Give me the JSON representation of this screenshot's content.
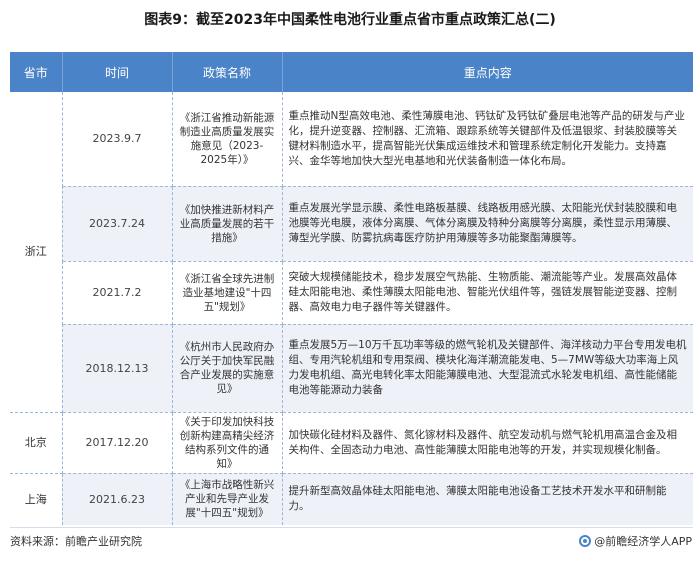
{
  "title": "图表9：截至2023年中国柔性电池行业重点省市重点政策汇总(二)",
  "headers": {
    "province": "省市",
    "time": "时间",
    "policy": "政策名称",
    "content": "重点内容"
  },
  "groups": [
    {
      "province": "浙江",
      "rows": [
        {
          "time": "2023.9.7",
          "policy": "《浙江省推动新能源制造业高质量发展实施意见（2023-2025年）》",
          "content": "重点推动N型高效电池、柔性薄膜电池、钙钛矿及钙钛矿叠层电池等产品的研发与产业化，提升逆变器、控制器、汇流箱、跟踪系统等关键部件及低温银浆、封装胶膜等关键材料制造水平，提高智能光伏集成运维技术和管理系统定制化开发能力。支持嘉兴、金华等地加快大型光电基地和光伏装备制造一体化布局。"
        },
        {
          "time": "2023.7.24",
          "policy": "《加快推进新材料产业高质量发展的若干措施》",
          "content": "重点发展光学显示膜、柔性电路板基膜、线路板用感光膜、太阳能光伏封装胶膜和电池膜等光电膜，液体分离膜、气体分离膜及特种分离膜等分离膜，柔性显示用薄膜、薄型光学膜、防雾抗病毒医疗防护用薄膜等多功能聚酯薄膜等。"
        },
        {
          "time": "2021.7.2",
          "policy": "《浙江省全球先进制造业基地建设\"十四五\"规划》",
          "content": "突破大规模储能技术，稳步发展空气热能、生物质能、潮流能等产业。发展高效晶体硅太阳能电池、柔性薄膜太阳能电池、智能光伏组件等，强链发展智能逆变器、控制器、高效电力电子器件等关键器件。"
        },
        {
          "time": "2018.12.13",
          "policy": "《杭州市人民政府办公厅关于加快军民融合产业发展的实施意见》",
          "content": "重点发展5万—10万千瓦功率等级的燃气轮机及关键部件、海洋核动力平台专用发电机组、专用汽轮机组和专用泵阀、模块化海洋潮流能发电、5—7MW等级大功率海上风力发电机组、高光电转化率太阳能薄膜电池、大型混流式水轮发电机组、高性能储能电池等能源动力装备"
        }
      ]
    },
    {
      "province": "北京",
      "rows": [
        {
          "time": "2017.12.20",
          "policy": "《关于印发加快科技创新构建高精尖经济结构系列文件的通知》",
          "content": "加快碳化硅材料及器件、氮化镓材料及器件、航空发动机与燃气轮机用高温合金及相关构件、全固态动力电池、高性能薄膜太阳能电池等的开发，并实现规模化制备。"
        }
      ]
    },
    {
      "province": "上海",
      "rows": [
        {
          "time": "2021.6.23",
          "policy": "《上海市战略性新兴产业和先导产业发展\"十四五\"规划》",
          "content": "提升新型高效晶体硅太阳能电池、薄膜太阳能电池设备工艺技术开发水平和研制能力。"
        }
      ]
    }
  ],
  "footer": {
    "source": "资料来源：前瞻产业研究院",
    "brand": "@前瞻经济学人APP"
  },
  "colors": {
    "header_bg": "#4a83c8",
    "alt_row_bg": "#eef2f8",
    "divider": "#9eb6d6"
  }
}
